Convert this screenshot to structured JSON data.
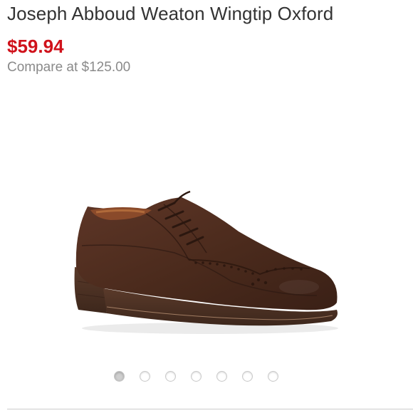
{
  "product": {
    "title": "Joseph Abboud Weaton Wingtip Oxford",
    "price": "$59.94",
    "compare_price": "Compare at $125.00",
    "image_icon": "brown-wingtip-oxford-shoe"
  },
  "carousel": {
    "total_slides": 7,
    "active_slide": 1
  },
  "colors": {
    "price": "#d0121b",
    "title": "#333333",
    "compare": "#8a8a8a",
    "shoe_leather": "#4a2a1c"
  }
}
